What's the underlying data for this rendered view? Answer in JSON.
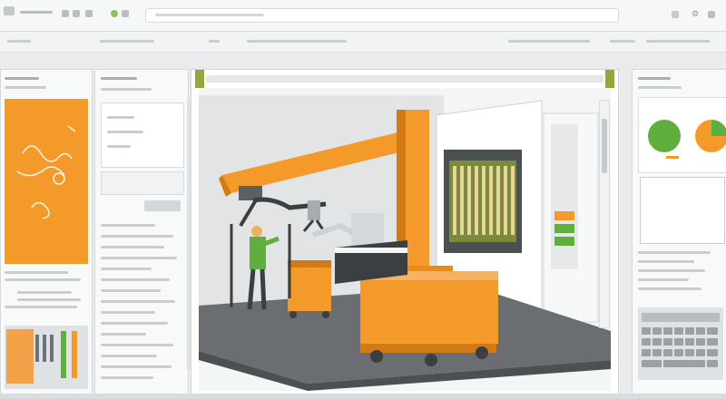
{
  "window": {
    "title": "",
    "tab_label": ""
  },
  "toolbar": {
    "icons": [
      "back-icon",
      "forward-icon",
      "home-icon",
      "clock-icon",
      "settings-icon",
      "search-icon",
      "close-icon"
    ]
  },
  "left_panel": {
    "header_label": "",
    "sub_label": ""
  },
  "middle_panel": {
    "header_label": ""
  },
  "right_panel": {
    "header_label": ""
  },
  "colors": {
    "accent_orange": "#f39a2b",
    "accent_green": "#5fae3e",
    "chrome_gray": "#e9ebec",
    "dark_floor": "#6b6e70"
  }
}
